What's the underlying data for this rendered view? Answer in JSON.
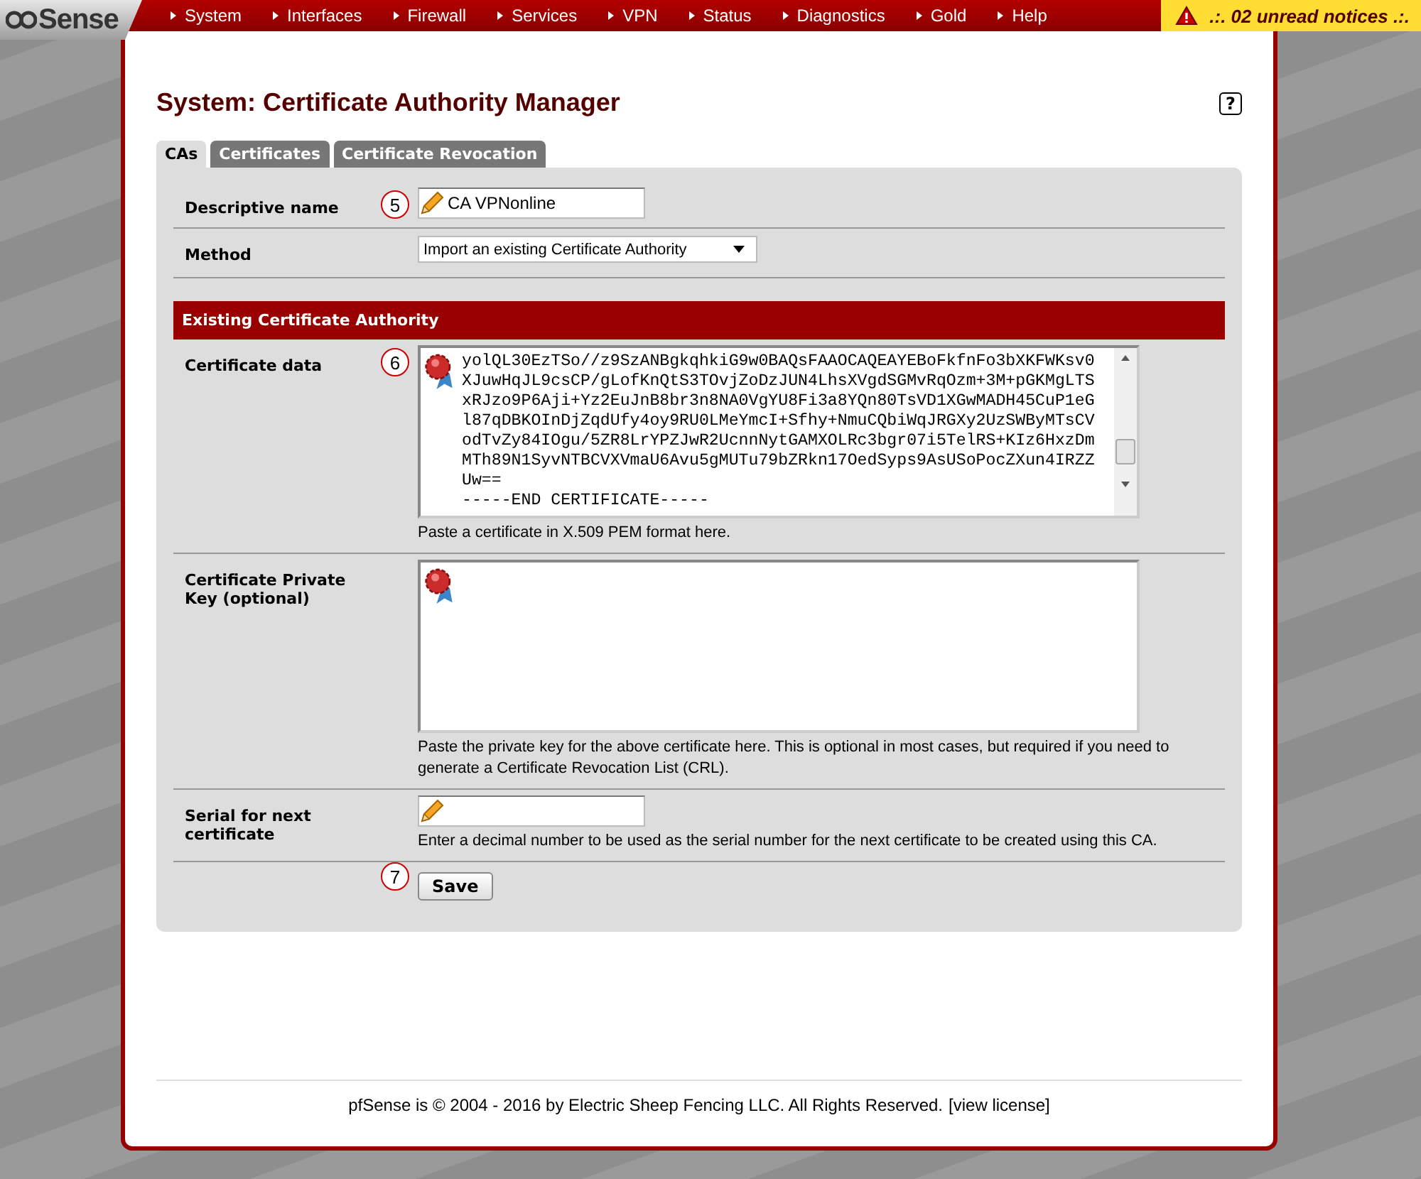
{
  "nav": {
    "logo": "Sense",
    "menu": [
      "System",
      "Interfaces",
      "Firewall",
      "Services",
      "VPN",
      "Status",
      "Diagnostics",
      "Gold",
      "Help"
    ],
    "notices": ".:. 02 unread notices .:."
  },
  "page": {
    "title": "System: Certificate Authority Manager",
    "help": "?"
  },
  "tabs": [
    {
      "label": "CAs",
      "selected": true
    },
    {
      "label": "Certificates",
      "selected": false
    },
    {
      "label": "Certificate Revocation",
      "selected": false
    }
  ],
  "rows": [
    {
      "kind": "input",
      "label": "Descriptive name",
      "marker": "5",
      "value": "CA VPNonline"
    },
    {
      "kind": "select",
      "label": "Method",
      "value": "Import an existing Certificate Authority"
    },
    {
      "kind": "section",
      "label": "Existing Certificate Authority"
    },
    {
      "kind": "textarea",
      "label": "Certificate data",
      "marker": "6",
      "value": "yolQL30EzTSo//z9SzANBgkqhkiG9w0BAQsFAAOCAQEAYEBoFkfnFo3bXKFWKsv0\nXJuwHqJL9csCP/gLofKnQtS3TOvjZoDzJUN4LhsXVgdSGMvRqOzm+3M+pGKMgLTS\nxRJzo9P6Aji+Yz2EuJnB8br3n8NA0VgYU8Fi3a8YQn80TsVD1XGwMADH45CuP1eG\nl87qDBKOInDjZqdUfy4oy9RU0LMeYmcI+Sfhy+NmuCQbiWqJRGXy2UzSWByMTsCV\nodTvZy84IOgu/5ZR8LrYPZJwR2UcnnNytGAMXOLRc3bgr07i5TelRS+KIz6HxzDm\nMTh89N1SyvNTBCVXVmaU6Avu5gMUTu79bZRkn17OedSyps9AsUSoPocZXun4IRZZ\nUw==\n-----END CERTIFICATE-----",
      "hint": "Paste a certificate in X.509 PEM format here."
    },
    {
      "kind": "textarea",
      "label": "Certificate Private Key (optional)",
      "hint": "Paste the private key for the above certificate here. This is optional in most cases, but required if you need to generate a Certificate Revocation List (CRL)."
    },
    {
      "kind": "input",
      "label": "Serial for next certificate",
      "hint": "Enter a decimal number to be used as the serial number for the next certificate to be created using this CA."
    },
    {
      "kind": "button",
      "label": "Save",
      "marker": "7"
    }
  ],
  "footer": {
    "text": "pfSense is © 2004 - 2016 by Electric Sheep Fencing LLC. All Rights Reserved.",
    "link": "[view license]"
  }
}
